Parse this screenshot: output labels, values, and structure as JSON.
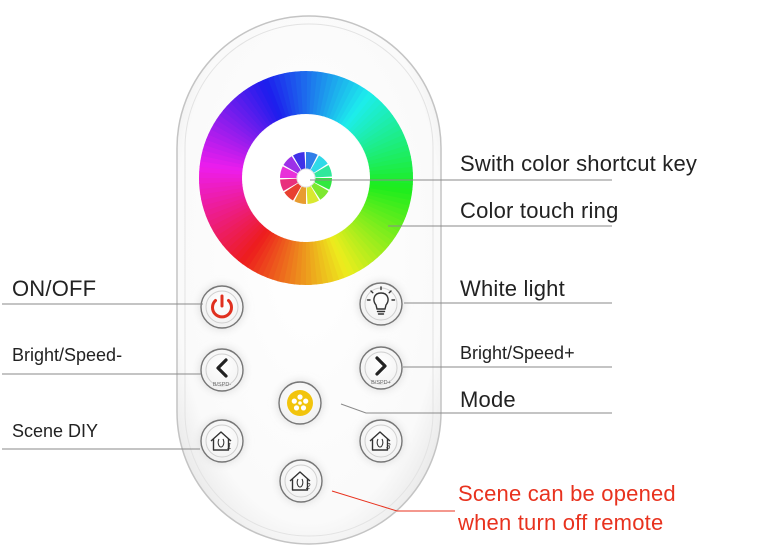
{
  "labels": {
    "switch_color": "Swith color shortcut key",
    "color_ring": "Color touch ring",
    "on_off": "ON/OFF",
    "white_light": "White light",
    "bright_minus": "Bright/Speed-",
    "bright_plus": "Bright/Speed+",
    "mode": "Mode",
    "scene_diy": "Scene DIY",
    "scene_open_line1": "Scene can be opened",
    "scene_open_line2": "when turn off remote"
  },
  "button_text": {
    "bspd_minus": "B/SPD-",
    "bspd_plus": "B/SPD+",
    "scene1": "1",
    "scene2": "2",
    "scene3": "3"
  },
  "colors": {
    "power_red": "#e0301f",
    "mode_yellow": "#f2c40c",
    "note_red": "#e8321e",
    "leader_gray": "#8a8a8a",
    "remote_outline": "#bdbdbd"
  }
}
